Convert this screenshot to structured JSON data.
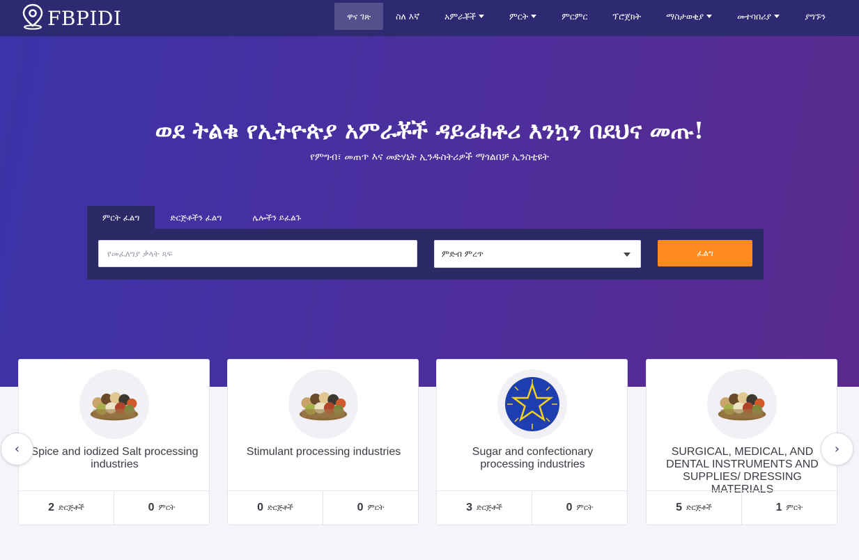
{
  "brand": {
    "name": "FBPIDI",
    "icon": "location-pin-icon"
  },
  "nav": {
    "items": [
      {
        "label": "ዋና ገጽ",
        "active": true,
        "dropdown": false
      },
      {
        "label": "ስለ እኛ",
        "active": false,
        "dropdown": false
      },
      {
        "label": "አምራቾች",
        "active": false,
        "dropdown": true
      },
      {
        "label": "ምርት",
        "active": false,
        "dropdown": true
      },
      {
        "label": "ምርምር",
        "active": false,
        "dropdown": false
      },
      {
        "label": "ፕሮጀክት",
        "active": false,
        "dropdown": false
      },
      {
        "label": "ማስታወቂያ",
        "active": false,
        "dropdown": true
      },
      {
        "label": "መተባበሪያ",
        "active": false,
        "dropdown": true
      },
      {
        "label": "ያግኙን",
        "active": false,
        "dropdown": false
      }
    ]
  },
  "hero": {
    "title": "ወደ ትልቁ የኢትዮጵያ አምራቾች ዳይሬክቶሪ እንኳን በደህና መጡ!",
    "subtitle": "የምግብ፣ መጠጥ እና መድሃኒት ኢንዱስትሪዎች ማጎልበቻ ኢንስቲዩት"
  },
  "search": {
    "tabs": [
      {
        "label": "ምርት ፈልግ",
        "active": true
      },
      {
        "label": "ድርጅቶችን ፈልግ",
        "active": false
      },
      {
        "label": "ሌሎችን ይፈልጉ",
        "active": false
      }
    ],
    "placeholder": "የመፈለግያ ቃላት ጻፍ",
    "category_selected": "ምድብ ምረጥ",
    "button_label": "ፈልግ"
  },
  "cards": [
    {
      "title": "Spice and iodized Salt processing industries",
      "companies": "2",
      "companies_label": "ድርጅቶች",
      "products": "0",
      "products_label": "ምርት",
      "image": "spices-image"
    },
    {
      "title": "Stimulant processing industries",
      "companies": "0",
      "companies_label": "ድርጅቶች",
      "products": "0",
      "products_label": "ምርት",
      "image": "spices-image"
    },
    {
      "title": "Sugar and confectionary processing industries",
      "companies": "3",
      "companies_label": "ድርጅቶች",
      "products": "0",
      "products_label": "ምርት",
      "image": "ethiopian-emblem-image"
    },
    {
      "title": "SURGICAL, MEDICAL, AND DENTAL INSTRUMENTS AND SUPPLIES/ DRESSING MATERIALS",
      "companies": "5",
      "companies_label": "ድርጅቶች",
      "products": "1",
      "products_label": "ምርት",
      "image": "spices-image"
    }
  ],
  "carousel": {
    "prev": "‹",
    "next": "›"
  },
  "colors": {
    "nav_bg": "#2e2a72",
    "accent": "#ff8a1f",
    "panel": "#2b2966"
  }
}
